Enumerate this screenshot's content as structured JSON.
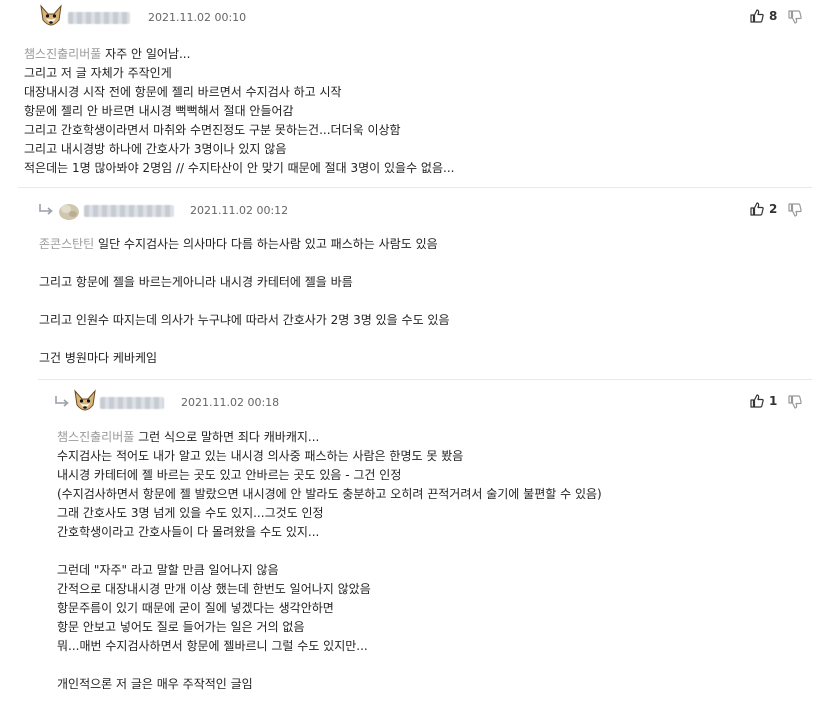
{
  "comments": [
    {
      "date": "2021.11.02 00:10",
      "likes": "8",
      "mention": "챔스진출리버풀",
      "lines": [
        "자주 안 일어남...",
        "그리고 저 글 자체가 주작인게",
        "대장내시경 시작 전에 항문에 젤리 바르면서 수지검사 하고 시작",
        "항문에 젤리 안 바르면 내시경 뻑뻑해서 절대 안들어감",
        "그리고 간호학생이라면서 마취와 수면진정도 구분 못하는건...더더욱 이상함",
        "그리고 내시경방 하나에 간호사가 3명이나 있지 않음",
        "적은데는 1명 많아봐야 2명임 // 수지타산이 안 맞기 때문에 절대 3명이 있을수 없음..."
      ]
    },
    {
      "date": "2021.11.02 00:12",
      "likes": "2",
      "mention": "존콘스탄틴",
      "lines": [
        "일단 수지검사는 의사마다 다름 하는사람 있고 패스하는 사람도 있음",
        "",
        "그리고 항문에 젤을 바르는게아니라 내시경 카테터에 젤을 바름",
        "",
        "그리고 인원수 따지는데 의사가 누구냐에 따라서 간호사가 2명 3명 있을 수도 있음",
        "",
        "그건 병원마다 케바케임"
      ]
    },
    {
      "date": "2021.11.02 00:18",
      "likes": "1",
      "mention": "챔스진출리버풀",
      "lines": [
        "그런 식으로 말하면 죄다 캐바캐지...",
        "수지검사는 적어도 내가 알고 있는 내시경 의사중 패스하는 사람은 한명도 못 봤음",
        "내시경 카테터에 젤 바르는 곳도 있고 안바르는 곳도 있음 - 그건 인정",
        "(수지검사하면서 항문에 젤 발랐으면 내시경에 안 발라도 충분하고 오히려 끈적거려서 술기에 불편할 수 있음)",
        "그래 간호사도 3명 넘게 있을 수도 있지...그것도 인정",
        "간호학생이라고 간호사들이 다 몰려왔을 수도 있지...",
        "",
        "그런데 \"자주\" 라고 말할 만큼 일어나지 않음",
        "간적으로 대장내시경 만개 이상 했는데 한번도 일어나지 않았음",
        "항문주름이 있기 때문에 굳이 질에 넣겠다는 생각안하면",
        "항문 안보고 넣어도 질로 들어가는 일은 거의 없음",
        "뭐...매번 수지검사하면서 항문에 젤바르니 그럴 수도 있지만...",
        "",
        "개인적으론 저 글은 매우 주작적인 글임"
      ]
    }
  ]
}
